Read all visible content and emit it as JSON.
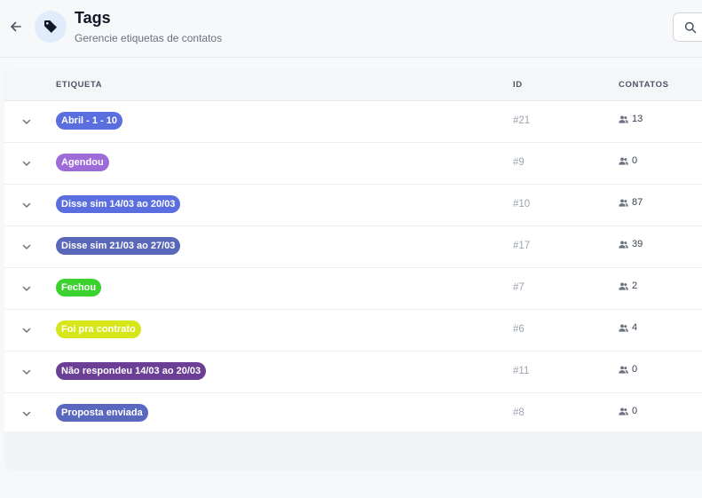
{
  "header": {
    "title": "Tags",
    "subtitle": "Gerencie etiquetas de contatos"
  },
  "table": {
    "columns": {
      "label": "ETIQUETA",
      "id": "ID",
      "contacts": "CONTATOS"
    },
    "rows": [
      {
        "label": "Abril - 1 - 10",
        "color": "#5a6ee0",
        "text_color": "#ffffff",
        "id": "#21",
        "contacts": "13"
      },
      {
        "label": "Agendou",
        "color": "#9d6cd8",
        "text_color": "#ffffff",
        "id": "#9",
        "contacts": "0"
      },
      {
        "label": "Disse sim 14/03 ao 20/03",
        "color": "#5a6ee0",
        "text_color": "#ffffff",
        "id": "#10",
        "contacts": "87"
      },
      {
        "label": "Disse sim 21/03 ao 27/03",
        "color": "#5867b8",
        "text_color": "#ffffff",
        "id": "#17",
        "contacts": "39"
      },
      {
        "label": "Fechou",
        "color": "#3bd12e",
        "text_color": "#ffffff",
        "id": "#7",
        "contacts": "2"
      },
      {
        "label": "Foi pra contrato",
        "color": "#d6e618",
        "text_color": "#ffffff",
        "id": "#6",
        "contacts": "4"
      },
      {
        "label": "Não respondeu 14/03 ao 20/03",
        "color": "#6a3f95",
        "text_color": "#ffffff",
        "id": "#11",
        "contacts": "0"
      },
      {
        "label": "Proposta enviada",
        "color": "#5a68c0",
        "text_color": "#ffffff",
        "id": "#8",
        "contacts": "0"
      }
    ]
  },
  "icons": {
    "back": "arrow-left-icon",
    "tag": "tag-icon",
    "search": "search-icon",
    "expand": "chevron-down-icon",
    "contacts": "users-icon"
  }
}
